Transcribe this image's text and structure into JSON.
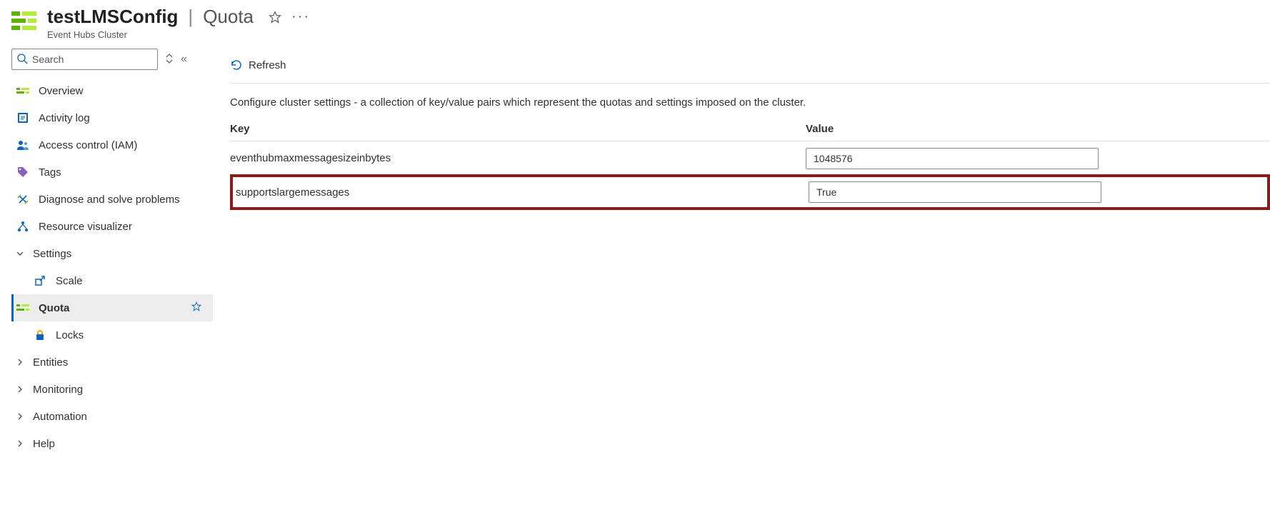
{
  "header": {
    "resource_name": "testLMSConfig",
    "page_name": "Quota",
    "resource_type": "Event Hubs Cluster"
  },
  "sidebar": {
    "search_placeholder": "Search",
    "items": {
      "overview": "Overview",
      "activity_log": "Activity log",
      "access_control": "Access control (IAM)",
      "tags": "Tags",
      "diagnose": "Diagnose and solve problems",
      "resource_visualizer": "Resource visualizer"
    },
    "settings_group": "Settings",
    "settings_items": {
      "scale": "Scale",
      "quota": "Quota",
      "locks": "Locks"
    },
    "collapsed_groups": {
      "entities": "Entities",
      "monitoring": "Monitoring",
      "automation": "Automation",
      "help": "Help"
    }
  },
  "toolbar": {
    "refresh_label": "Refresh"
  },
  "content": {
    "description": "Configure cluster settings - a collection of key/value pairs which represent the quotas and settings imposed on the cluster.",
    "key_header": "Key",
    "value_header": "Value",
    "rows": [
      {
        "key": "eventhubmaxmessagesizeinbytes",
        "value": "1048576"
      },
      {
        "key": "supportslargemessages",
        "value": "True"
      }
    ]
  }
}
